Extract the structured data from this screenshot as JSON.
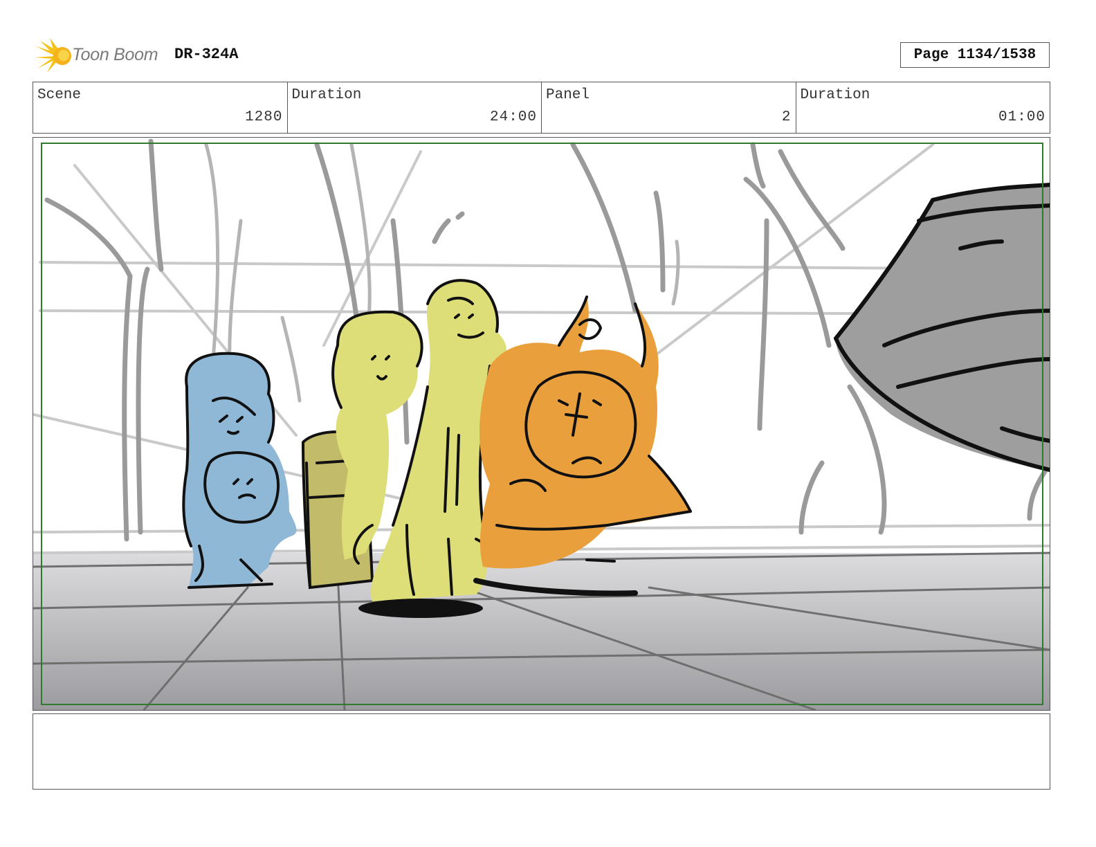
{
  "header": {
    "logo_text": "Toon Boom",
    "document_id": "DR-324A",
    "page_label": "Page 1134/1538"
  },
  "info": {
    "scene_label": "Scene",
    "scene_value": "1280",
    "scene_duration_label": "Duration",
    "scene_duration_value": "24:00",
    "panel_label": "Panel",
    "panel_value": "2",
    "panel_duration_label": "Duration",
    "panel_duration_value": "01:00"
  },
  "colors": {
    "blue_character": "#8fb8d6",
    "yellow_character": "#dede78",
    "olive_character": "#c2bc6a",
    "orange_character": "#e9a03c",
    "safe_frame": "#2f7a2f"
  },
  "notes": ""
}
